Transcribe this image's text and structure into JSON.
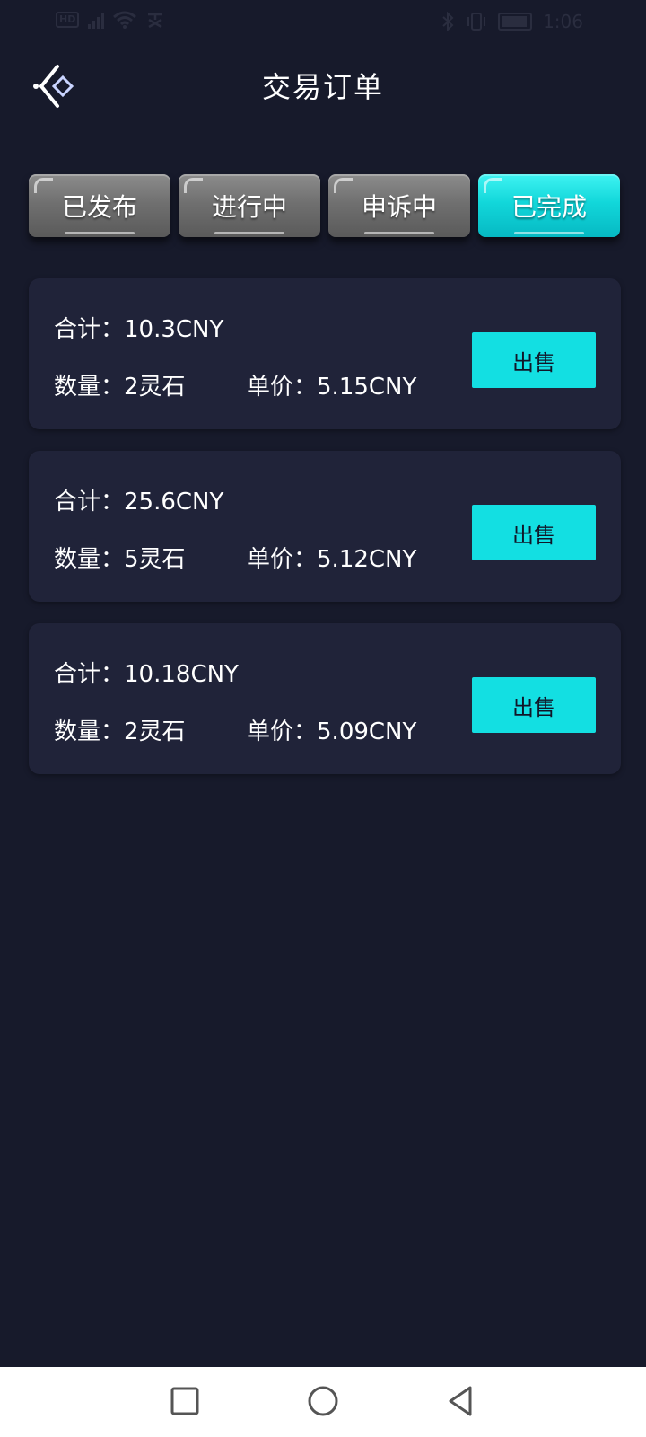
{
  "status_bar": {
    "network": "HD",
    "time": "1:06",
    "icons": [
      "hd-icon",
      "signal-icon",
      "wifi-icon",
      "bluetooth-icon",
      "vibrate-icon",
      "battery-icon"
    ]
  },
  "header": {
    "title": "交易订单",
    "back_icon": "back-diamond-icon"
  },
  "tabs": [
    {
      "label": "已发布",
      "active": false
    },
    {
      "label": "进行中",
      "active": false
    },
    {
      "label": "申诉中",
      "active": false
    },
    {
      "label": "已完成",
      "active": true
    }
  ],
  "orders": [
    {
      "total_label": "合计：",
      "total": "10.3CNY",
      "qty_label": "数量：",
      "qty": "2灵石",
      "price_label": "单价：",
      "price": "5.15CNY",
      "action": "出售"
    },
    {
      "total_label": "合计：",
      "total": "25.6CNY",
      "qty_label": "数量：",
      "qty": "5灵石",
      "price_label": "单价：",
      "price": "5.12CNY",
      "action": "出售"
    },
    {
      "total_label": "合计：",
      "total": "10.18CNY",
      "qty_label": "数量：",
      "qty": "2灵石",
      "price_label": "单价：",
      "price": "5.09CNY",
      "action": "出售"
    }
  ],
  "colors": {
    "background": "#171a2b",
    "card": "#202339",
    "accent": "#13dfe2",
    "tab_inactive": "#707070"
  },
  "nav_bar": {
    "icons": [
      "recent-apps-icon",
      "home-icon",
      "back-icon"
    ]
  }
}
